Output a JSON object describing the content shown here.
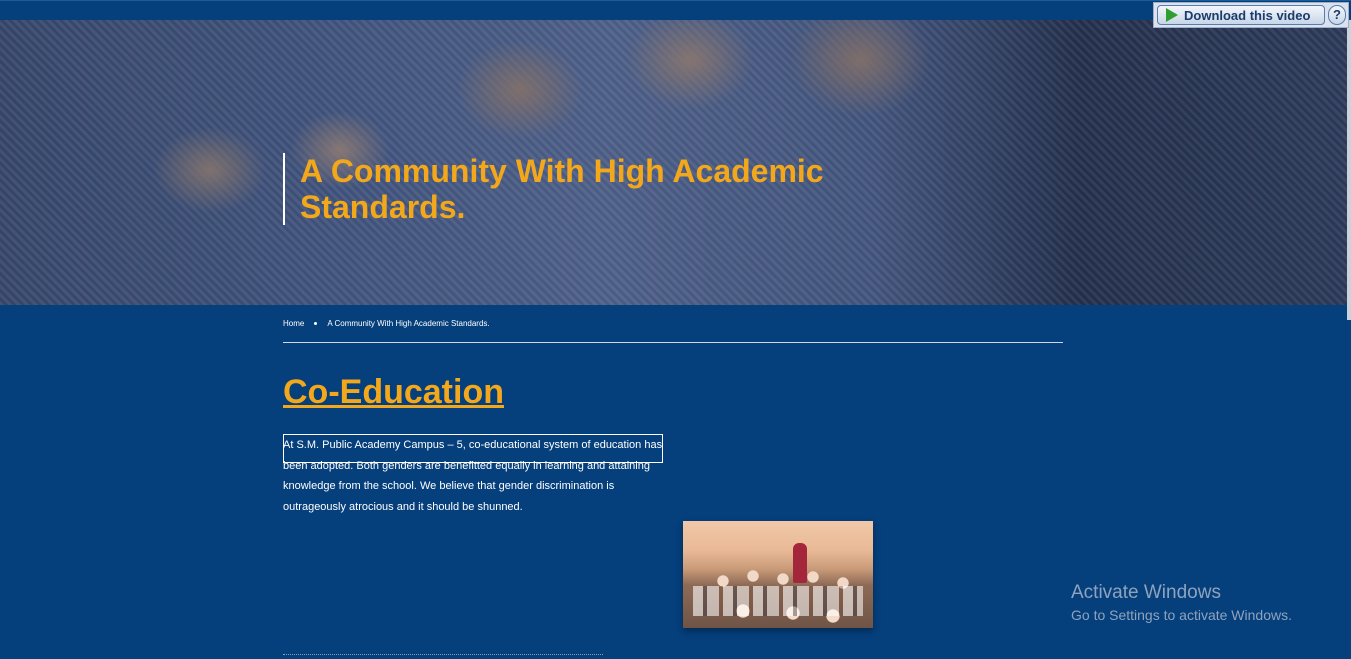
{
  "download_bar": {
    "button_label": "Download this video",
    "help_label": "?"
  },
  "hero": {
    "title": "A Community With High Academic Standards."
  },
  "breadcrumb": {
    "home": "Home",
    "current": "A Community With High Academic Standards."
  },
  "section": {
    "title": "Co-Education",
    "paragraph": "At S.M. Public Academy Campus – 5, co-educational system of education has been adopted. Both genders are benefitted equally in learning and attaining knowledge from the school. We believe that gender discrimination is outrageously atrocious and it should be shunned."
  },
  "watermark": {
    "title": "Activate Windows",
    "subtitle": "Go to Settings to activate Windows."
  },
  "colors": {
    "background": "#053f7c",
    "accent": "#f3a81b",
    "text": "#ffffff"
  },
  "icons": {
    "download": "play-icon",
    "help": "help-icon"
  }
}
